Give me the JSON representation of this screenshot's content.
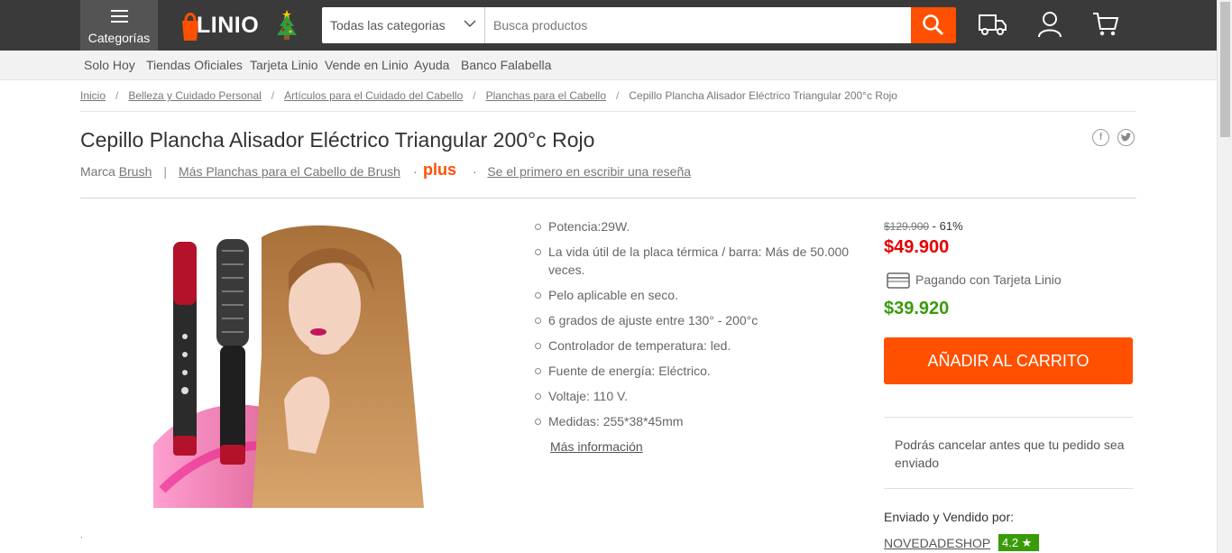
{
  "header": {
    "categories_label": "Categorías",
    "logo_text": "LINIO",
    "search_category": "Todas las categorias",
    "search_placeholder": "Busca productos"
  },
  "subnav": [
    "Solo Hoy",
    "Tiendas Oficiales",
    "Tarjeta Linio",
    "Vende en Linio",
    "Ayuda",
    "Banco Falabella"
  ],
  "breadcrumb": [
    "Inicio",
    "Belleza y Cuidado Personal",
    "Artículos para el Cuidado del Cabello",
    "Planchas para el Cabello",
    "Cepillo Plancha Alisador Eléctrico Triangular 200°c Rojo"
  ],
  "product": {
    "title": "Cepillo Plancha Alisador Eléctrico Triangular 200°c Rojo",
    "brand_prefix": "Marca",
    "brand": "Brush",
    "more_link": "Más Planchas para el Cabello de Brush",
    "plus": "plus",
    "review_link": "Se el primero en escribir una reseña",
    "features": [
      "Potencia:29W.",
      "La vida útil de la placa térmica / barra: Más de 50.000 veces.",
      "Pelo aplicable en seco.",
      "6 grados de ajuste entre 130° - 200°c",
      "Controlador de temperatura: led.",
      "Fuente de energía: Eléctrico.",
      "Voltaje: 110 V.",
      "Medidas: 255*38*45mm"
    ],
    "more_info": "Más información",
    "tiny_dot": "."
  },
  "pricing": {
    "old_price": "$129.900",
    "discount": " - 61%",
    "price": "$49.900",
    "card_label": "Pagando con Tarjeta Linio",
    "card_price": "$39.920",
    "add_to_cart": "AÑADIR AL CARRITO",
    "cancel_note": "Podrás cancelar antes que tu pedido sea enviado",
    "sold_by_label": "Enviado y Vendido por:",
    "seller": "NOVEDADESHOP",
    "rating": "4.2 ★"
  },
  "colors": {
    "brand_orange": "#ff5000",
    "topbar": "#3a3a3a",
    "price_red": "#e60000",
    "card_green": "#3a9b0a"
  }
}
